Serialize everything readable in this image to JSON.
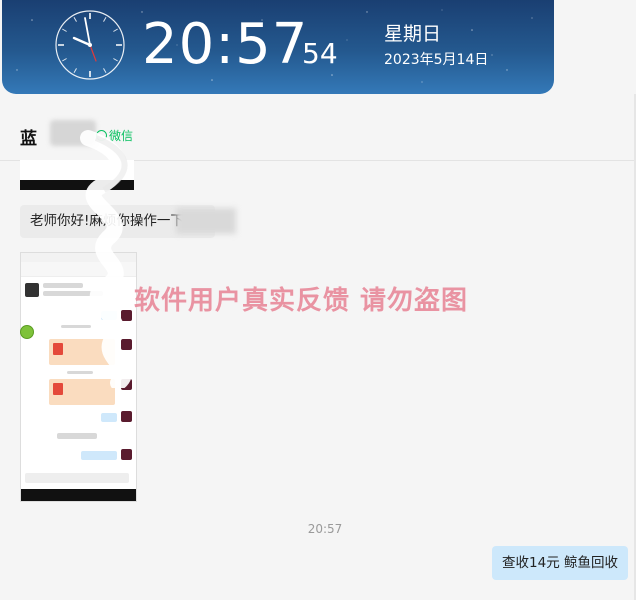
{
  "clock": {
    "time": "20:57",
    "seconds": "54",
    "weekday": "星期日",
    "date": "2023年5月14日"
  },
  "chat": {
    "contact_name": "蓝",
    "contact_source": "微信",
    "incoming_message": "老师你好!麻烦你操作一下，",
    "timestamp": "20:57",
    "outgoing_message": "查收14元  鲸鱼回收"
  },
  "watermark": "软件用户真实反馈  请勿盗图",
  "colors": {
    "clock_bg_top": "#1a3f72",
    "clock_bg_bottom": "#3479b8",
    "wechat_green": "#07c160",
    "outgoing_bubble": "#cde8fb",
    "incoming_bubble": "#ebebeb",
    "watermark": "#e8899a"
  }
}
